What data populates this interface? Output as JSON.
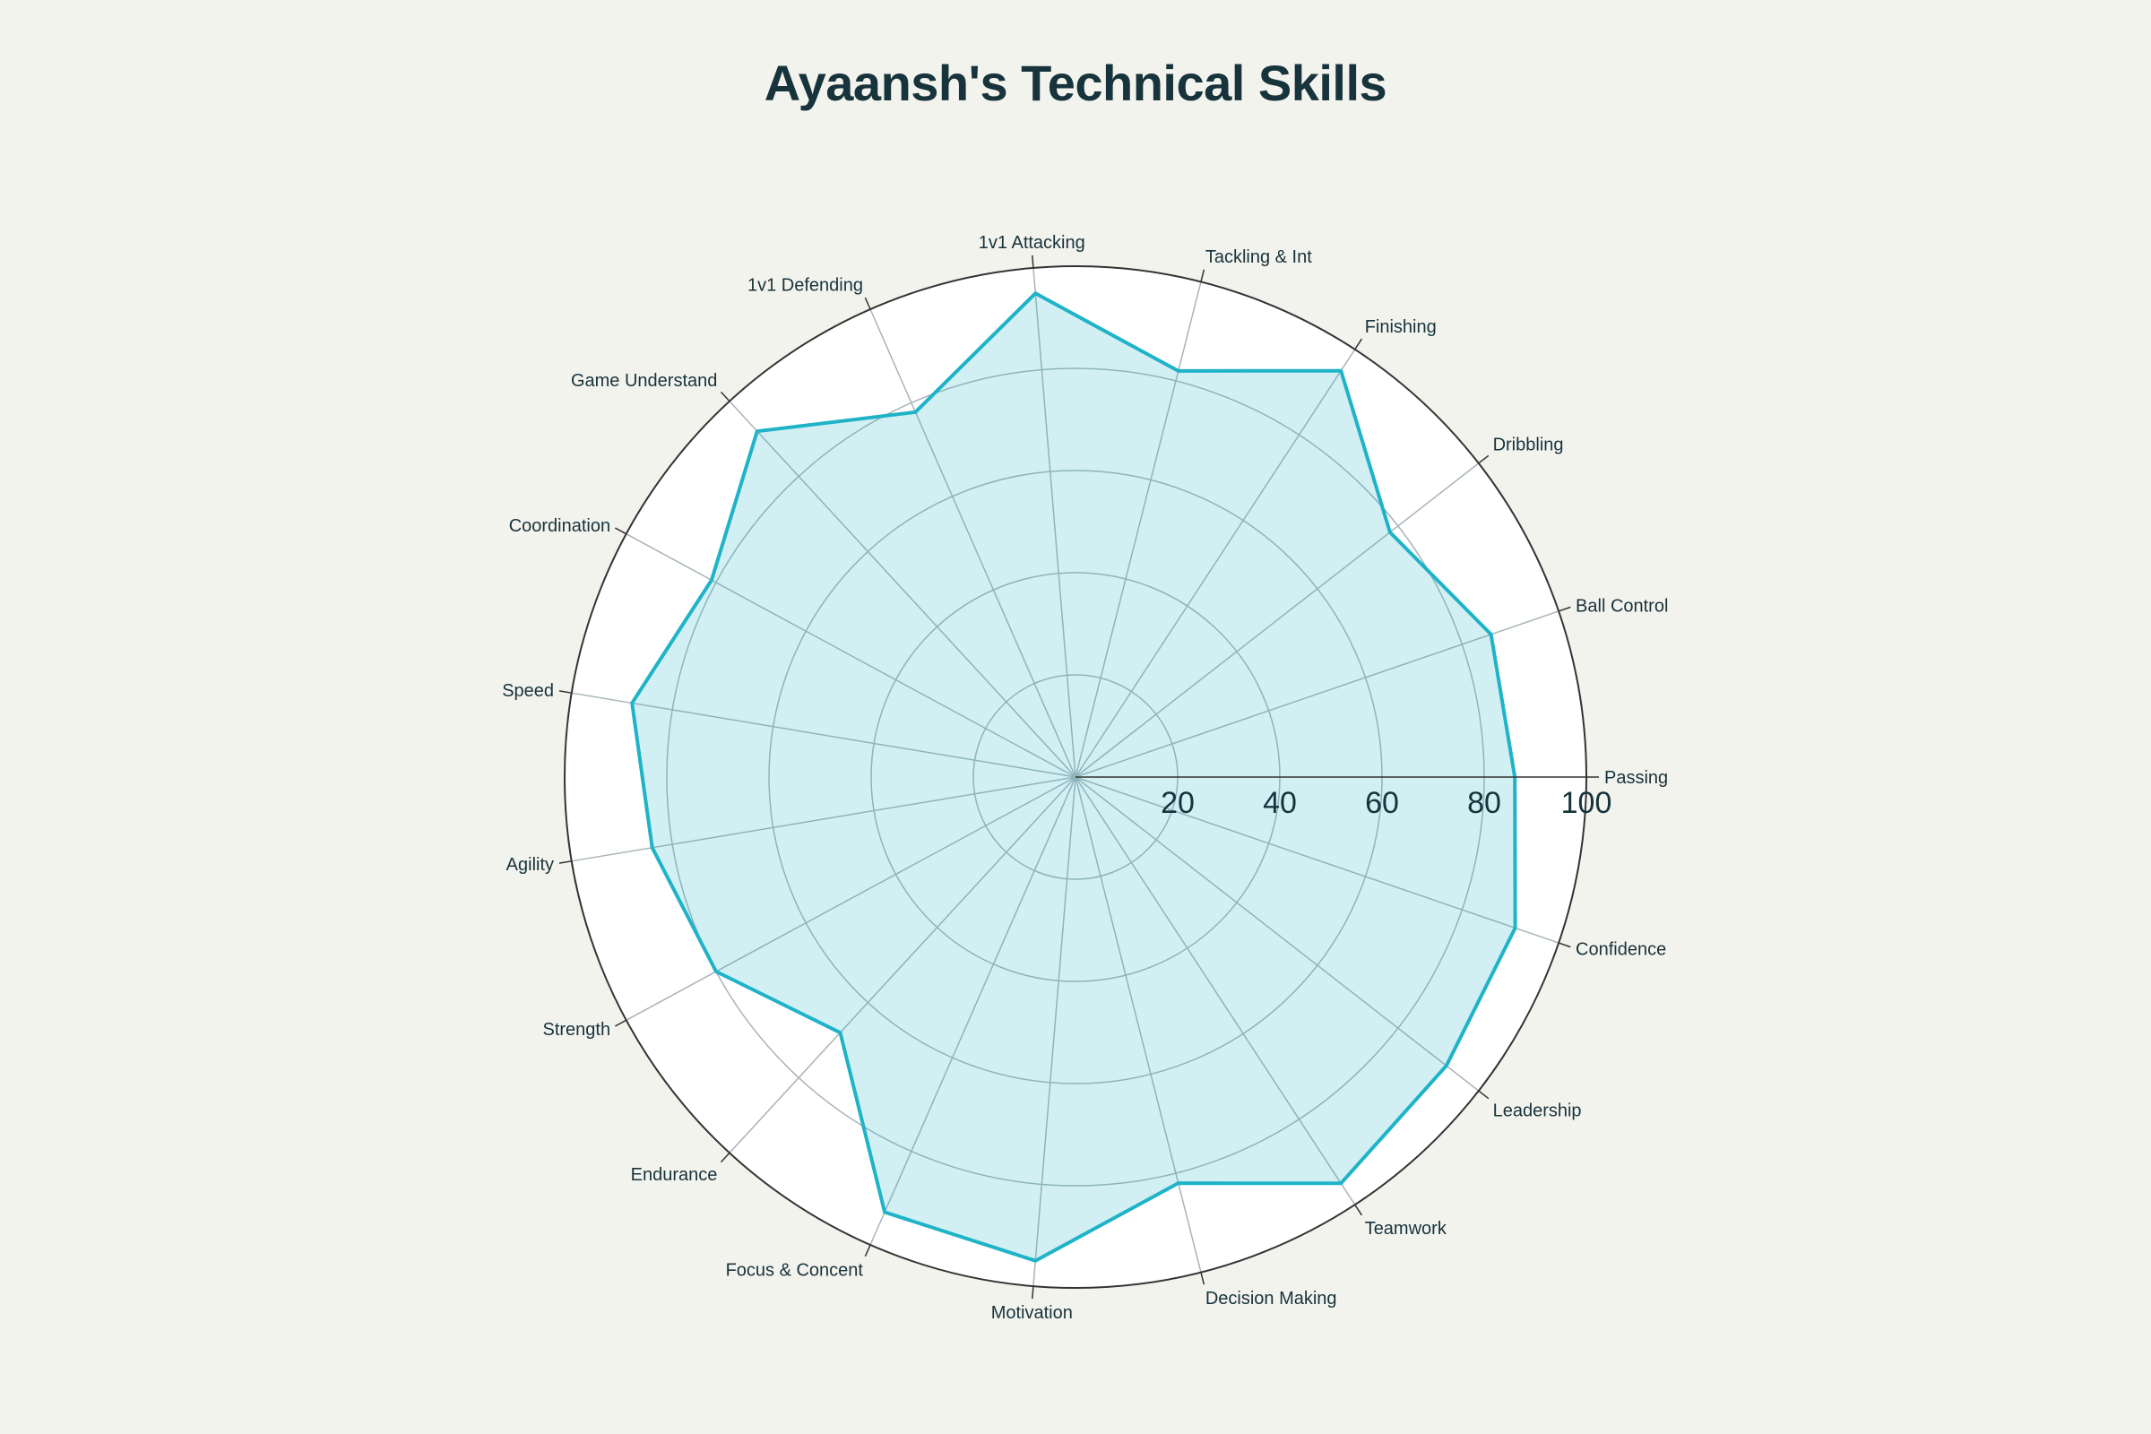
{
  "chart_data": {
    "type": "radar",
    "title": "Ayaansh's Technical Skills",
    "categories": [
      "Passing",
      "Ball Control",
      "Dribbling",
      "Finishing",
      "Tackling & Int",
      "1v1 Attacking",
      "1v1 Defending",
      "Game Understand",
      "Coordination",
      "Speed",
      "Agility",
      "Strength",
      "Endurance",
      "Focus & Concent",
      "Motivation",
      "Decision Making",
      "Teamwork",
      "Leadership",
      "Confidence"
    ],
    "series": [
      {
        "name": "",
        "values": [
          86,
          86,
          78,
          95,
          82,
          95,
          78,
          92,
          81,
          88,
          84,
          80,
          68,
          93,
          95,
          82,
          95,
          92,
          91
        ],
        "color": "#1fb3c8",
        "fill": "#1fb3c8"
      }
    ],
    "radial_range": [
      0,
      100
    ],
    "radial_ticks": [
      20,
      40,
      60,
      80,
      100
    ],
    "radial_tick_labels": [
      "20",
      "40",
      "60",
      "80",
      "100"
    ],
    "grid": true,
    "legend": false
  },
  "colors": {
    "background": "#f3f3ee",
    "plot_background": "#ffffff",
    "series_line": "#1fb3c8",
    "grid": "#a9b4b8",
    "text": "#17333b"
  }
}
